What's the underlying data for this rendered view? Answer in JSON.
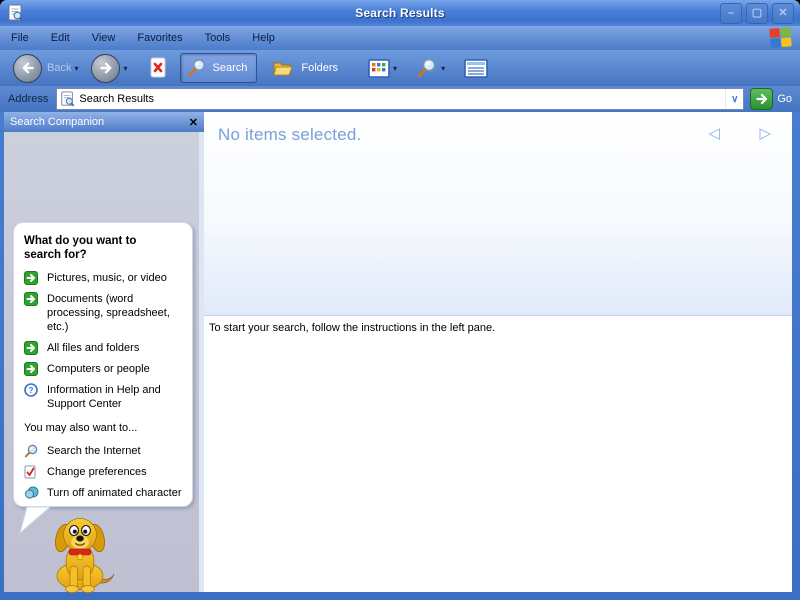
{
  "window": {
    "title": "Search Results",
    "controls": {
      "minimize": "–",
      "maximize": "▢",
      "close": "✕"
    }
  },
  "menu_bar": {
    "items": [
      "File",
      "Edit",
      "View",
      "Favorites",
      "Tools",
      "Help"
    ]
  },
  "toolbar": {
    "back_label": "Back",
    "search_label": "Search",
    "folders_label": "Folders"
  },
  "address_bar": {
    "label": "Address",
    "value": "Search Results",
    "go_label": "Go"
  },
  "sidebar": {
    "title": "Search Companion",
    "bubble": {
      "heading": "What do you want to search for?",
      "search_links": [
        {
          "icon": "green-arrow-icon",
          "label": "Pictures, music, or video"
        },
        {
          "icon": "green-arrow-icon",
          "label": "Documents (word processing, spreadsheet, etc.)"
        },
        {
          "icon": "green-arrow-icon",
          "label": "All files and folders"
        },
        {
          "icon": "green-arrow-icon",
          "label": "Computers or people"
        },
        {
          "icon": "help-icon",
          "label": "Information in Help and Support Center"
        }
      ],
      "secondary_heading": "You may also want to...",
      "secondary_links": [
        {
          "icon": "internet-search-icon",
          "label": "Search the Internet"
        },
        {
          "icon": "preferences-icon",
          "label": "Change preferences"
        },
        {
          "icon": "character-icon",
          "label": "Turn off animated character"
        }
      ]
    },
    "character_icon": "rover-dog-character"
  },
  "content": {
    "status_heading": "No items selected.",
    "instructions": "To start your search, follow the instructions in the left pane."
  },
  "icons": {
    "nav_back_glyph": "◁",
    "nav_forward_glyph": "▷",
    "dropdown_glyph": "▾",
    "combo_dropdown_glyph": "∨",
    "sidebar_close_glyph": "✕"
  },
  "colors": {
    "titlebar_blue": "#4a80d8",
    "window_border_blue": "#3a6fc4",
    "pane_body_grey": "#c4c7d6",
    "status_heading_blue": "#77a0da",
    "green_arrow": "#2fa22f",
    "go_green": "#2c8f32"
  }
}
